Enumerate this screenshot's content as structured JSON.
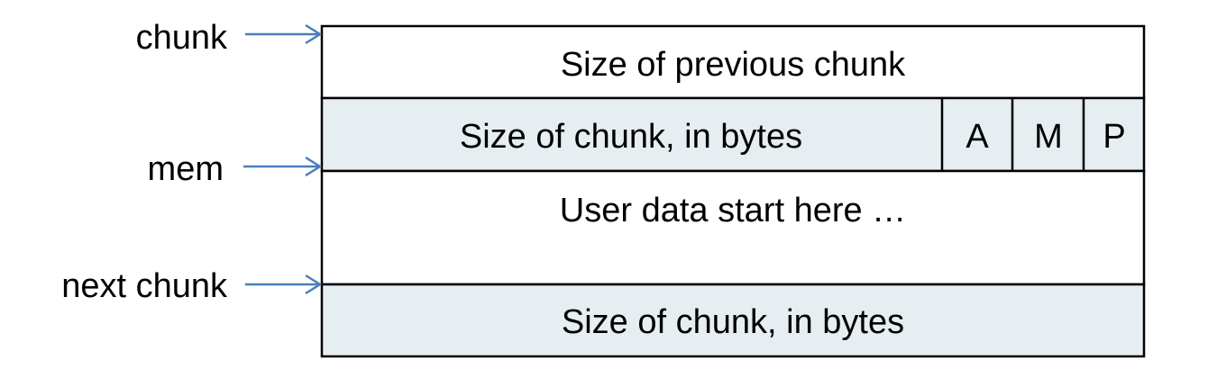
{
  "pointers": {
    "chunk": "chunk",
    "mem": "mem",
    "next_chunk": "next chunk"
  },
  "rows": {
    "prev_size": "Size of previous chunk",
    "size": "Size of chunk, in bytes",
    "flag_a": "A",
    "flag_m": "M",
    "flag_p": "P",
    "user_data": "User data start here …",
    "next_size": "Size of chunk, in bytes"
  },
  "colors": {
    "shaded_fill": "#e7eef2",
    "arrow": "#4a7ebb"
  }
}
